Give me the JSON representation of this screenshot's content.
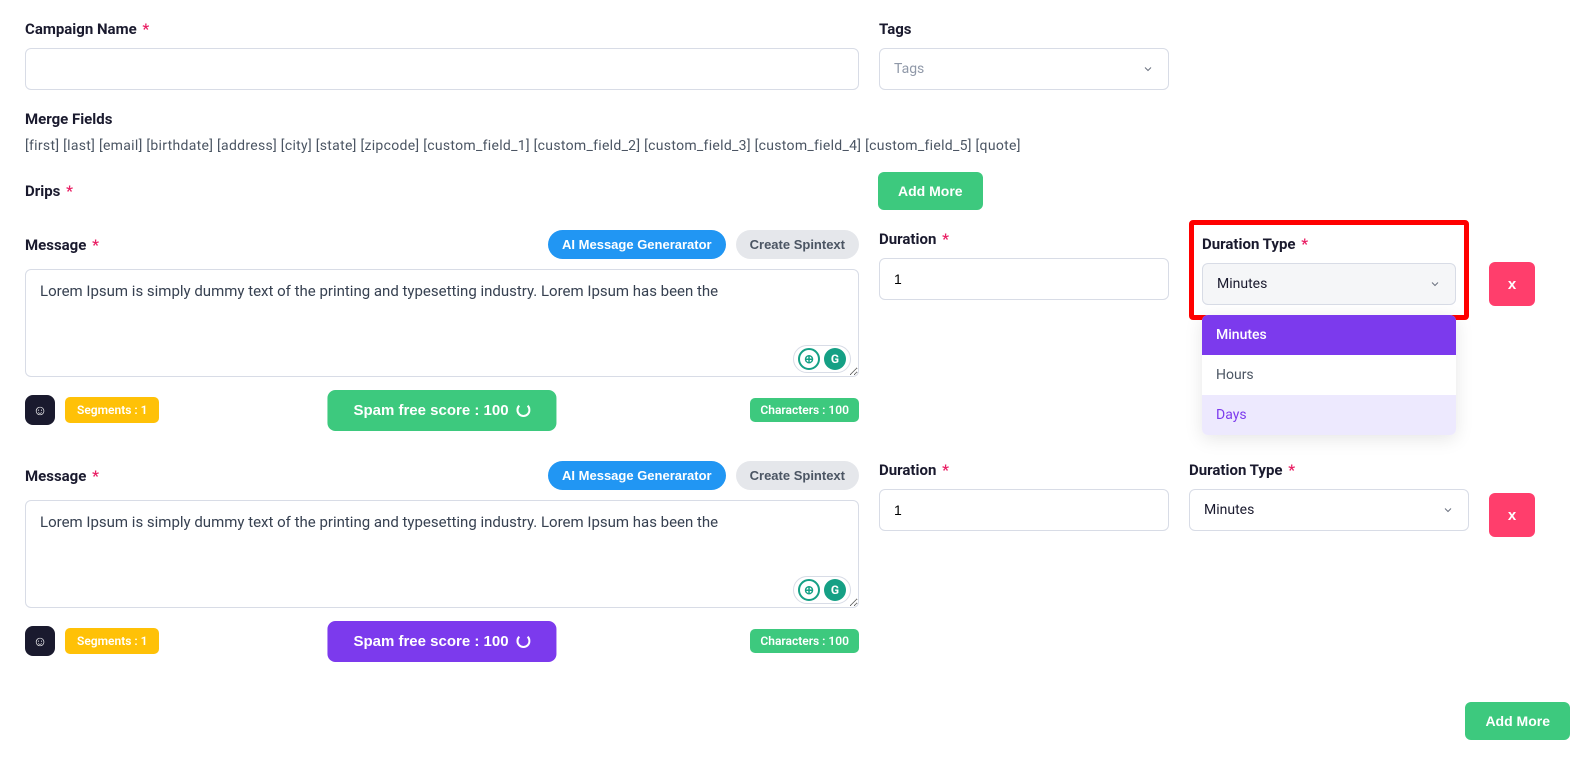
{
  "labels": {
    "campaign_name": "Campaign Name",
    "tags": "Tags",
    "merge_fields": "Merge Fields",
    "drips": "Drips",
    "message": "Message",
    "duration": "Duration",
    "duration_type": "Duration Type"
  },
  "tags_placeholder": "Tags",
  "merge_fields_text": "[first] [last] [email] [birthdate] [address] [city] [state] [zipcode] [custom_field_1] [custom_field_2] [custom_field_3] [custom_field_4] [custom_field_5] [quote]",
  "buttons": {
    "add_more": "Add More",
    "ai_generator": "AI Message Generarator",
    "create_spintext": "Create Spintext",
    "delete": "x"
  },
  "drips_list": [
    {
      "message": "Lorem Ipsum is simply dummy text of the printing and typesetting industry. Lorem Ipsum has been the",
      "segments": "Segments : 1",
      "spam_score": "Spam free score : 100",
      "characters": "Characters : 100",
      "duration": "1",
      "duration_type": "Minutes",
      "spam_style": "green",
      "dropdown_open": true,
      "highlighted": true
    },
    {
      "message": "Lorem Ipsum is simply dummy text of the printing and typesetting industry. Lorem Ipsum has been the",
      "segments": "Segments : 1",
      "spam_score": "Spam free score : 100",
      "characters": "Characters : 100",
      "duration": "1",
      "duration_type": "Minutes",
      "spam_style": "purple",
      "dropdown_open": false,
      "highlighted": false
    }
  ],
  "duration_type_options": [
    "Minutes",
    "Hours",
    "Days"
  ],
  "widget_icons": {
    "lightbulb": "⊕",
    "grammarly": "G"
  }
}
